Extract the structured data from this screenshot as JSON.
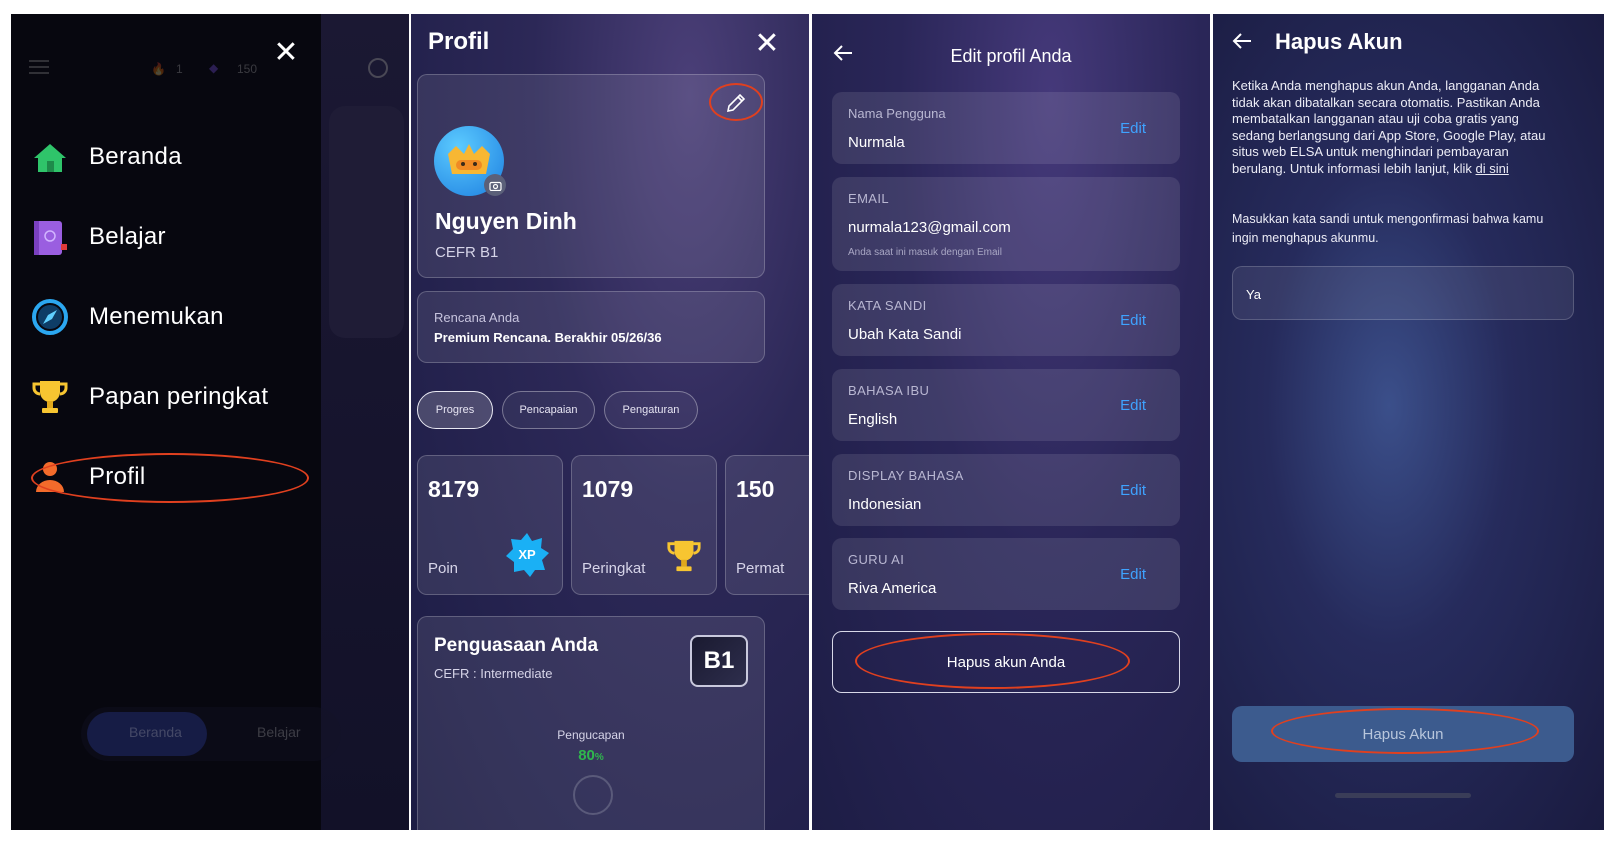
{
  "panel1": {
    "bg_counts": {
      "streak": "1",
      "gems": "150"
    },
    "menu": [
      {
        "label": "Beranda",
        "icon": "home-icon"
      },
      {
        "label": "Belajar",
        "icon": "book-icon"
      },
      {
        "label": "Menemukan",
        "icon": "compass-icon"
      },
      {
        "label": "Papan peringkat",
        "icon": "trophy-icon"
      },
      {
        "label": "Profil",
        "icon": "person-icon"
      }
    ],
    "bottom_nav": {
      "home": "Beranda",
      "learn": "Belajar"
    }
  },
  "panel2": {
    "title": "Profil",
    "name": "Nguyen Dinh",
    "cefr": "CEFR B1",
    "plan_label": "Rencana Anda",
    "plan_value": "Premium Rencana. Berakhir 05/26/36",
    "tabs": [
      "Progres",
      "Pencapaian",
      "Pengaturan"
    ],
    "stats": [
      {
        "value": "8179",
        "label": "Poin"
      },
      {
        "value": "1079",
        "label": "Peringkat"
      },
      {
        "value": "150",
        "label": "Permat"
      }
    ],
    "xp_badge": "XP",
    "mastery_title": "Penguasaan Anda",
    "mastery_sub": "CEFR : Intermediate",
    "mastery_level": "B1",
    "pron_label": "Pengucapan",
    "pron_value": "80",
    "pron_unit": "%"
  },
  "panel3": {
    "title": "Edit profil Anda",
    "edit_label": "Edit",
    "fields": [
      {
        "label": "Nama Pengguna",
        "value": "Nurmala"
      },
      {
        "label": "EMAIL",
        "value": "nurmala123@gmail.com",
        "note": "Anda saat ini masuk dengan Email"
      },
      {
        "label": "KATA SANDI",
        "value": "Ubah Kata Sandi"
      },
      {
        "label": "BAHASA IBU",
        "value": "English"
      },
      {
        "label": "DISPLAY BAHASA",
        "value": "Indonesian"
      },
      {
        "label": "GURU AI",
        "value": "Riva America"
      }
    ],
    "delete_button": "Hapus akun Anda"
  },
  "panel4": {
    "title": "Hapus Akun",
    "para1": "Ketika Anda menghapus akun Anda, langganan Anda tidak akan dibatalkan secara otomatis. Pastikan Anda membatalkan langganan atau uji coba gratis yang sedang berlangsung dari App Store, Google Play, atau situs web ELSA untuk menghindari pembayaran berulang. Untuk informasi lebih lanjut, klik",
    "link": "di sini",
    "para2": "Masukkan kata sandi untuk mengonfirmasi bahwa kamu ingin menghapus akunmu.",
    "input_value": "Ya",
    "button": "Hapus Akun"
  },
  "colors": {
    "accent_blue": "#3fa3ff",
    "highlight": "#e0401f",
    "success": "#2fb84d"
  }
}
